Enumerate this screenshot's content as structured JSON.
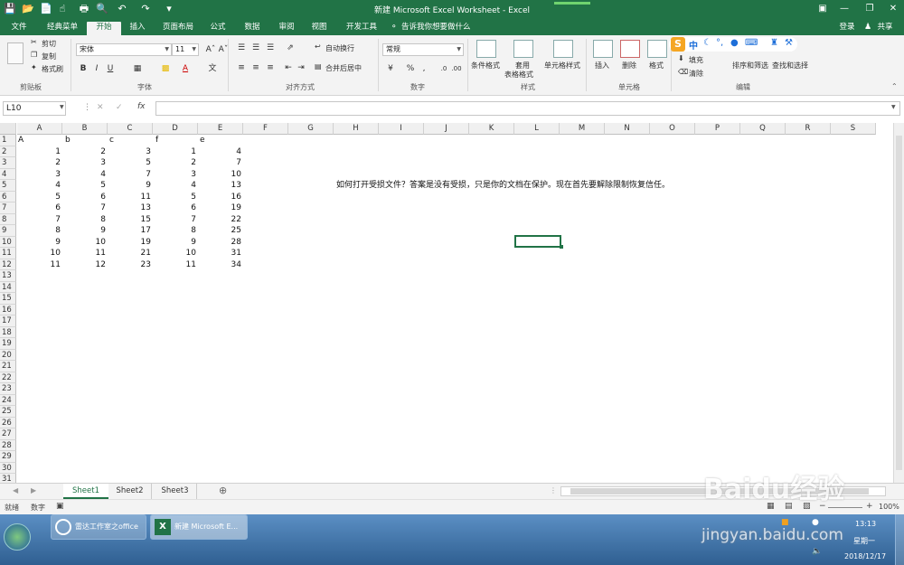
{
  "window": {
    "title": "新建 Microsoft Excel Worksheet - Excel",
    "login_label": "登录",
    "share_label": "共享"
  },
  "tabs": [
    {
      "label": "文件"
    },
    {
      "label": "经典菜单"
    },
    {
      "label": "开始"
    },
    {
      "label": "插入"
    },
    {
      "label": "页面布局"
    },
    {
      "label": "公式"
    },
    {
      "label": "数据"
    },
    {
      "label": "审阅"
    },
    {
      "label": "视图"
    },
    {
      "label": "开发工具"
    }
  ],
  "tell_me": "告诉我你想要做什么",
  "ribbon": {
    "clipboard": {
      "cut": "剪切",
      "copy": "复制",
      "format_painter": "格式刷",
      "group": "剪贴板"
    },
    "font": {
      "name": "宋体",
      "size": "11",
      "group": "字体"
    },
    "alignment": {
      "wrap": "自动换行",
      "merge": "合并后居中",
      "group": "对齐方式"
    },
    "number": {
      "format": "常规",
      "group": "数字"
    },
    "styles": {
      "conditional": "条件格式",
      "table_line1": "套用",
      "table_line2": "表格格式",
      "cell_styles": "单元格样式",
      "group": "样式"
    },
    "cells": {
      "insert": "插入",
      "delete": "删除",
      "format": "格式",
      "group": "单元格"
    },
    "editing": {
      "fill": "填充",
      "clear": "清除",
      "sort": "排序和筛选",
      "find": "查找和选择",
      "group": "编辑"
    }
  },
  "formula_bar": {
    "name_box": "L10",
    "fx": "fx"
  },
  "columns": [
    "A",
    "B",
    "C",
    "D",
    "E",
    "F",
    "G",
    "H",
    "I",
    "J",
    "K",
    "L",
    "M",
    "N",
    "O",
    "P",
    "Q",
    "R",
    "S"
  ],
  "rows": [
    "1",
    "2",
    "3",
    "4",
    "5",
    "6",
    "7",
    "8",
    "9",
    "10",
    "11",
    "12",
    "13",
    "14",
    "15",
    "16",
    "17",
    "18",
    "19",
    "20",
    "21",
    "22",
    "23",
    "24",
    "25",
    "26",
    "27",
    "28",
    "29",
    "30",
    "31"
  ],
  "cells": {
    "header": [
      "A",
      "b",
      "c",
      "f",
      "e"
    ],
    "data": [
      [
        "1",
        "2",
        "3",
        "1",
        "4"
      ],
      [
        "2",
        "3",
        "5",
        "2",
        "7"
      ],
      [
        "3",
        "4",
        "7",
        "3",
        "10"
      ],
      [
        "4",
        "5",
        "9",
        "4",
        "13"
      ],
      [
        "5",
        "6",
        "11",
        "5",
        "16"
      ],
      [
        "6",
        "7",
        "13",
        "6",
        "19"
      ],
      [
        "7",
        "8",
        "15",
        "7",
        "22"
      ],
      [
        "8",
        "9",
        "17",
        "8",
        "25"
      ],
      [
        "9",
        "10",
        "19",
        "9",
        "28"
      ],
      [
        "10",
        "11",
        "21",
        "10",
        "31"
      ],
      [
        "11",
        "12",
        "23",
        "11",
        "34"
      ]
    ],
    "note": "如何打开受损文件？答案是没有受损，只是你的文档在保护。现在首先要解除限制恢复信任。"
  },
  "sheets": [
    "Sheet1",
    "Sheet2",
    "Sheet3"
  ],
  "status": {
    "ready": "就绪",
    "numlock": "数字",
    "zoom": "100%"
  },
  "taskbar": {
    "items": [
      "雷达工作室之office",
      "新建 Microsoft E..."
    ],
    "time": "13:13",
    "weekday": "星期一",
    "date": "2018/12/17"
  },
  "watermark": {
    "brand": "Baidu经验",
    "url": "jingyan.baidu.com"
  },
  "colors": {
    "excel_green": "#217346",
    "taskbar_blue": "#2f5f91"
  }
}
